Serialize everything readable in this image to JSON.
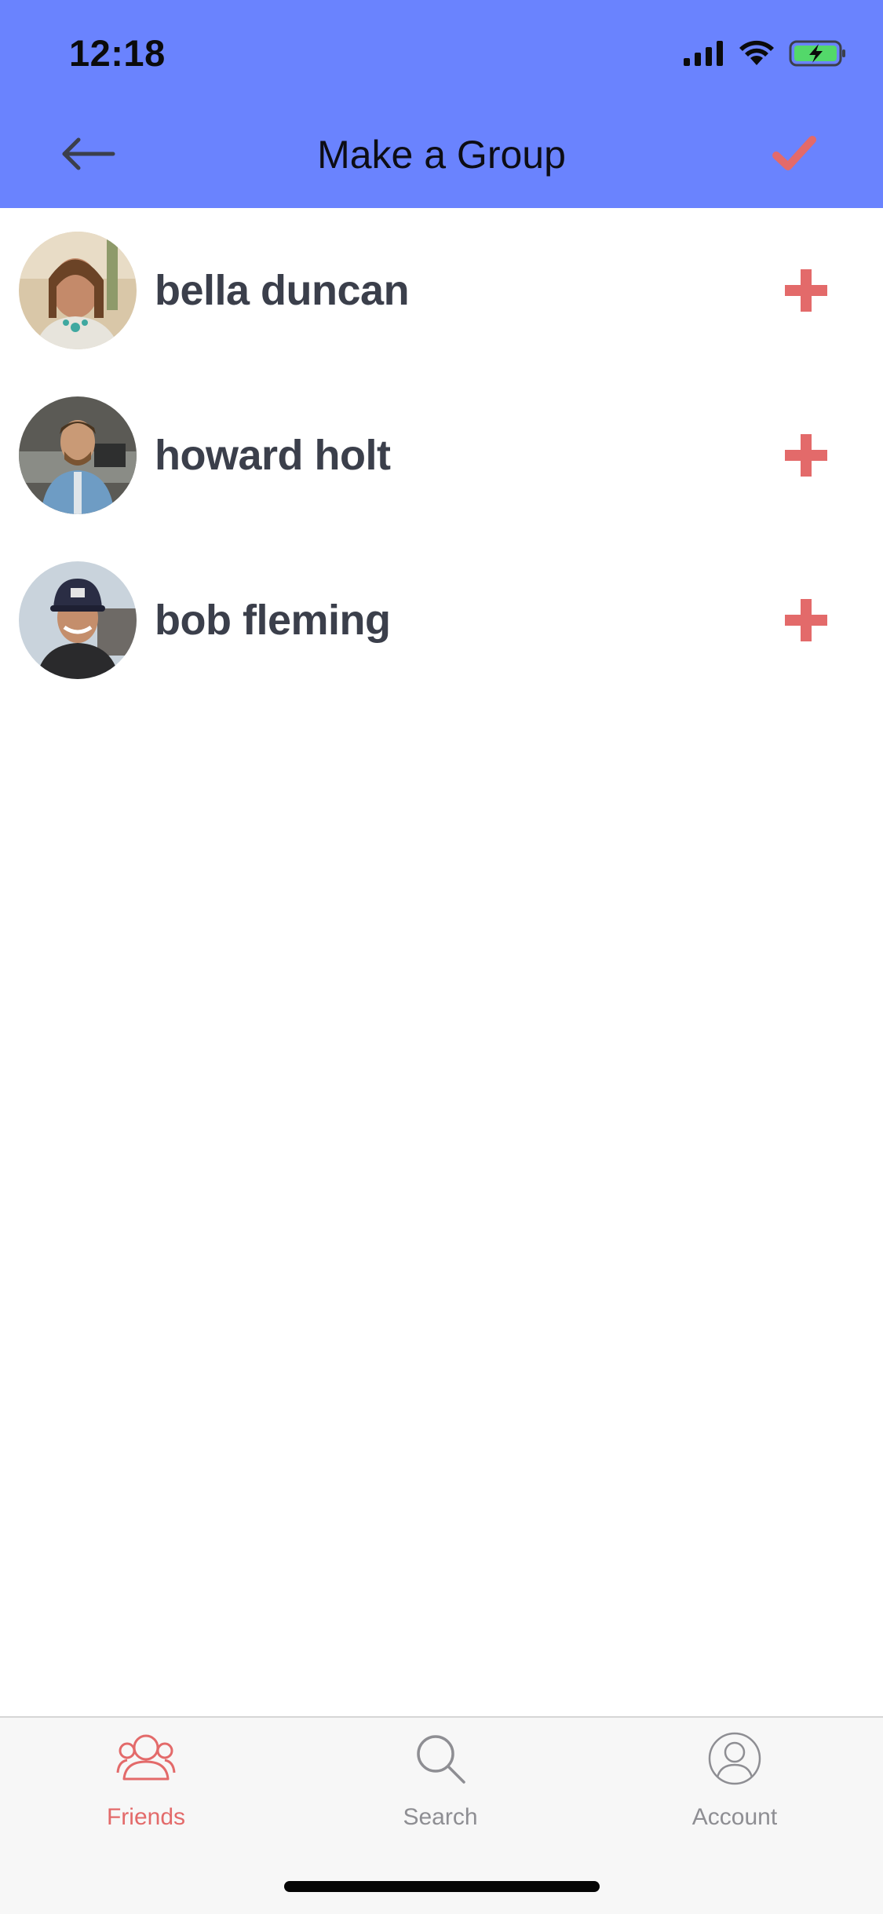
{
  "status_bar": {
    "time": "12:18"
  },
  "header": {
    "title": "Make a Group",
    "back_icon": "arrow-left-icon",
    "confirm_icon": "checkmark-icon"
  },
  "friends": [
    {
      "name": "bella duncan",
      "avatar": "avatar-photo",
      "action_icon": "plus-icon"
    },
    {
      "name": "howard holt",
      "avatar": "avatar-photo",
      "action_icon": "plus-icon"
    },
    {
      "name": "bob fleming",
      "avatar": "avatar-photo",
      "action_icon": "plus-icon"
    }
  ],
  "tabs": [
    {
      "label": "Friends",
      "icon": "friends-icon",
      "active": true
    },
    {
      "label": "Search",
      "icon": "search-icon",
      "active": false
    },
    {
      "label": "Account",
      "icon": "account-icon",
      "active": false
    }
  ],
  "colors": {
    "header_bg": "#6a83fe",
    "accent": "#e36a6a",
    "name_text": "#3b3f4b",
    "tab_inactive": "#8e8e93"
  }
}
